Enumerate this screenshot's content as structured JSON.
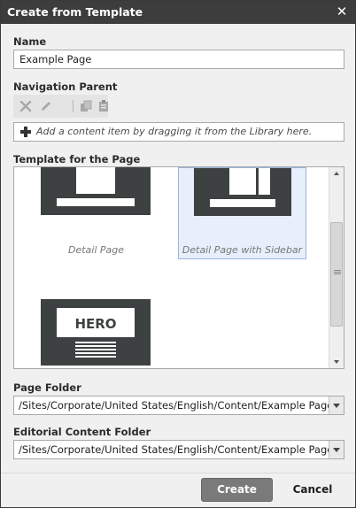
{
  "dialog": {
    "title": "Create from Template",
    "close_icon": "close-icon"
  },
  "name_field": {
    "label": "Name",
    "value": "Example Page"
  },
  "navigation_parent": {
    "label": "Navigation Parent",
    "toolbar": [
      "remove-icon",
      "edit-icon",
      "copy-icon",
      "paste-icon"
    ],
    "drop_hint": "Add a content item by dragging it from the Library here."
  },
  "templates": {
    "label": "Template for the Page",
    "items": [
      {
        "name": "Detail Page",
        "selected": false
      },
      {
        "name": "Detail Page with Sidebar",
        "selected": true
      },
      {
        "name": "",
        "thumb_text": "HERO",
        "selected": false
      }
    ]
  },
  "page_folder": {
    "label": "Page Folder",
    "value": "/Sites/Corporate/United States/English/Content/Example Page"
  },
  "editorial_folder": {
    "label": "Editorial Content Folder",
    "value": "/Sites/Corporate/United States/English/Content/Example Page"
  },
  "buttons": {
    "create": "Create",
    "cancel": "Cancel"
  },
  "colors": {
    "title_bar": "#3d3d3d",
    "thumb_dark": "#3d4142",
    "selection": "#e6effb",
    "create_button": "#7a7a7a"
  }
}
